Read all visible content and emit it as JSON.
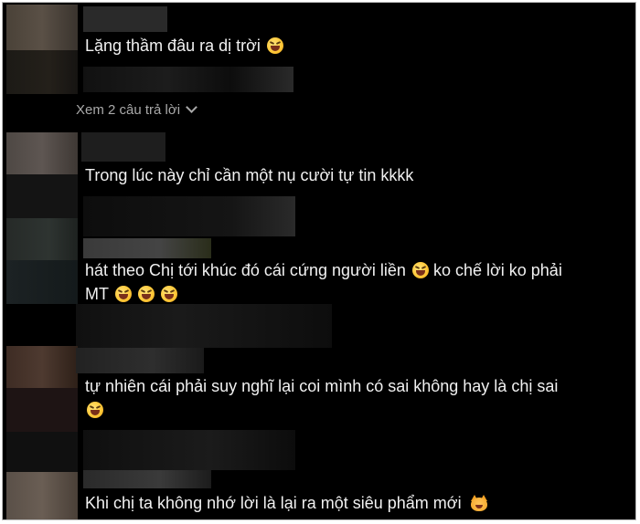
{
  "comments": [
    {
      "text": "Lặng thầm đâu ra dị trời",
      "emoji": [
        "rofl"
      ]
    },
    {
      "text": "Trong lúc này chỉ cần một nụ cười tự tin kkkk",
      "emoji": []
    },
    {
      "line1": "hát theo Chị tới khúc đó cái cứng người liền",
      "emoji_mid": [
        "rofl"
      ],
      "line1_tail": "ko chế lời ko phải",
      "line2": "MT",
      "emoji_end": [
        "rofl",
        "rofl",
        "rofl"
      ]
    },
    {
      "line1": "tự nhiên cái phải suy nghĩ lại coi mình có sai không hay là chị sai",
      "emoji": [
        "rofl"
      ]
    },
    {
      "text": "Khi chị ta không nhớ lời là lại ra một siêu phẩm mới",
      "emoji": [
        "grinning-cat"
      ]
    }
  ],
  "replies_link": "Xem 2 câu trả lời",
  "colors": {
    "background": "#000000",
    "text": "#f1f1f1",
    "muted": "#a9a9a9"
  }
}
